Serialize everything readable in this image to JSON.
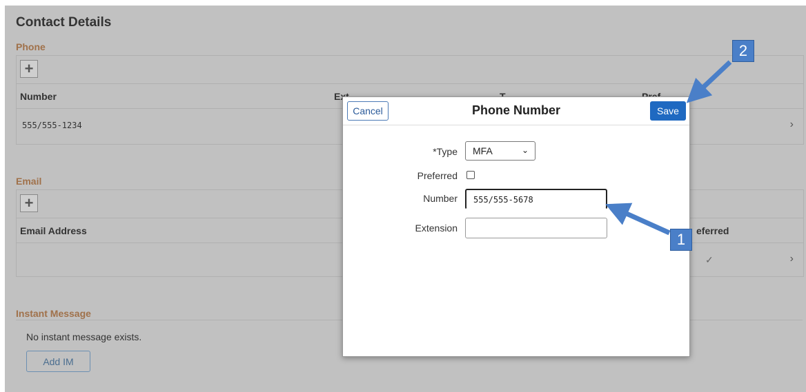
{
  "page": {
    "title": "Contact Details"
  },
  "phone": {
    "section_label": "Phone",
    "add_icon": "plus-icon",
    "columns": [
      "Number",
      "Ext",
      "T",
      "Pref"
    ],
    "rows": [
      {
        "number": "555/555-1234"
      }
    ]
  },
  "email": {
    "section_label": "Email",
    "add_icon": "plus-icon",
    "columns": [
      "Email Address",
      "eferred"
    ]
  },
  "im": {
    "section_label": "Instant Message",
    "empty_text": "No instant message exists.",
    "add_label": "Add IM"
  },
  "modal": {
    "cancel_label": "Cancel",
    "title": "Phone Number",
    "save_label": "Save",
    "type_label": "*Type",
    "type_value": "MFA",
    "preferred_label": "Preferred",
    "preferred_checked": false,
    "number_label": "Number",
    "number_value": "555/555-5678",
    "extension_label": "Extension",
    "extension_value": ""
  },
  "callouts": {
    "one": "1",
    "two": "2",
    "color": "#4a7fc8"
  },
  "icons": {
    "chevron": "chevron-right-icon",
    "check": "checkmark-icon",
    "dropdown": "chevron-down-icon"
  }
}
